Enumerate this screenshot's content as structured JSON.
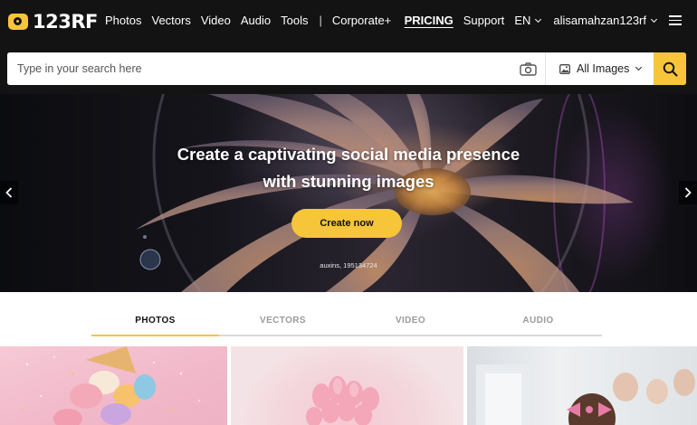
{
  "brand": {
    "logo_text": "123RF"
  },
  "nav": {
    "links": [
      "Photos",
      "Vectors",
      "Video",
      "Audio",
      "Tools"
    ],
    "separator": "|",
    "corporate": "Corporate+",
    "pricing": "PRICING",
    "support": "Support",
    "language": "EN",
    "username": "alisamahzan123rf"
  },
  "search": {
    "placeholder": "Type in your search here",
    "value": "",
    "type_selected": "All Images"
  },
  "hero": {
    "title_line1": "Create a captivating social media presence",
    "title_line2": "with stunning images",
    "cta": "Create now",
    "credit": "auxins, 195134724"
  },
  "tabs": [
    {
      "label": "PHOTOS",
      "active": true
    },
    {
      "label": "VECTORS",
      "active": false
    },
    {
      "label": "VIDEO",
      "active": false
    },
    {
      "label": "AUDIO",
      "active": false
    }
  ],
  "colors": {
    "accent": "#f7c53a",
    "topbar": "#131313"
  },
  "icons": {
    "camera": "camera-icon",
    "image_type": "image-icon",
    "search": "search-icon",
    "menu": "hamburger-menu-icon",
    "prev": "chevron-left-icon",
    "next": "chevron-right-icon"
  }
}
